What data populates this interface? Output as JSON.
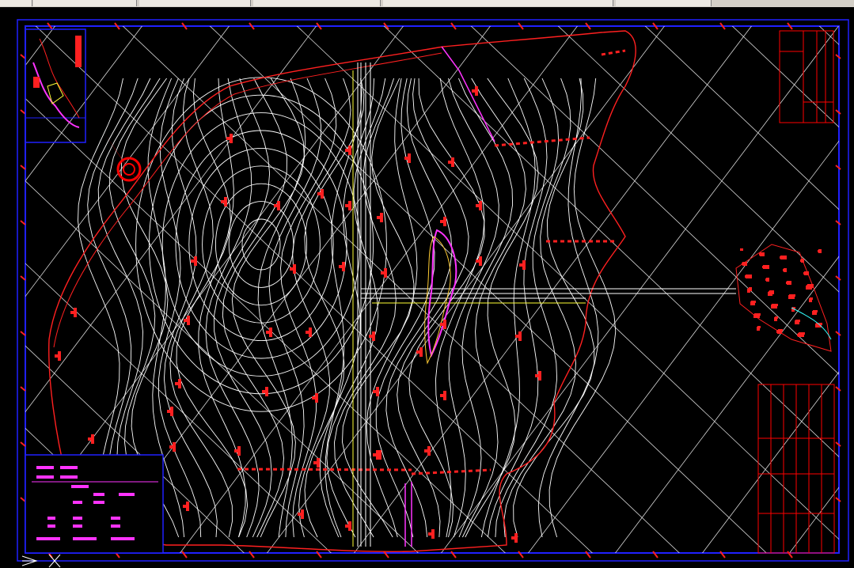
{
  "app": {
    "toolbar_segments": 6
  },
  "drawing": {
    "frame_color": "#2020ff",
    "contour_color": "#ffffff",
    "boundary_color": "#ff2020",
    "accent_magenta": "#ff33ff",
    "accent_yellow": "#ffff33",
    "accent_cyan": "#33ffff",
    "grid_color": "#ffffff",
    "title_block_color": "#ff0000",
    "north_arrow_color": "#ff0000"
  },
  "icons": {
    "ucs": "ucs-icon",
    "north_arrow": "north-arrow-icon",
    "crosshair": "crosshair-icon"
  }
}
